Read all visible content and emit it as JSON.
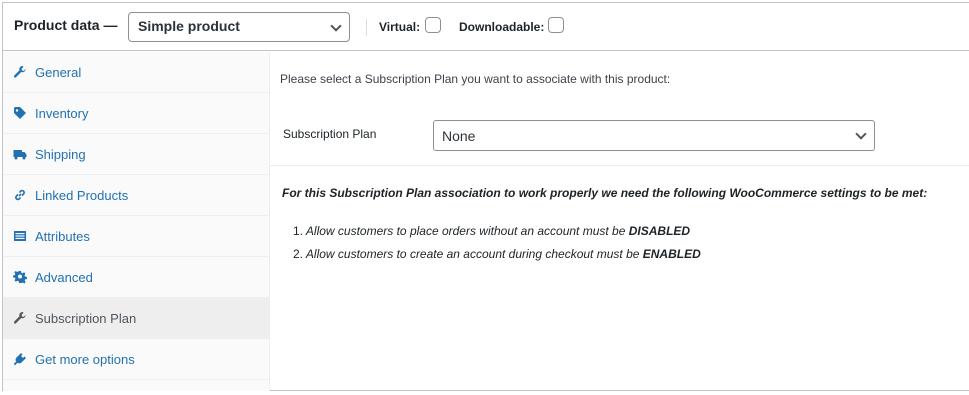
{
  "header": {
    "title": "Product data —",
    "product_type": "Simple product",
    "virtual_label": "Virtual:",
    "downloadable_label": "Downloadable:"
  },
  "sidebar": {
    "items": [
      {
        "label": "General",
        "icon": "wrench-icon"
      },
      {
        "label": "Inventory",
        "icon": "tag-icon"
      },
      {
        "label": "Shipping",
        "icon": "truck-icon"
      },
      {
        "label": "Linked Products",
        "icon": "link-icon"
      },
      {
        "label": "Attributes",
        "icon": "list-icon"
      },
      {
        "label": "Advanced",
        "icon": "gear-icon"
      },
      {
        "label": "Subscription Plan",
        "icon": "wrench-icon",
        "active": true
      },
      {
        "label": "Get more options",
        "icon": "plugin-icon"
      }
    ]
  },
  "main": {
    "intro": "Please select a Subscription Plan you want to associate with this product:",
    "plan_label": "Subscription Plan",
    "plan_value": "None",
    "notice": "For this Subscription Plan association to work properly we need the following WooCommerce settings to be met:",
    "requirements": [
      {
        "num": "1.",
        "text": "Allow customers to place orders without an account must be",
        "status": "DISABLED"
      },
      {
        "num": "2.",
        "text": "Allow customers to create an account during checkout must be",
        "status": "ENABLED"
      }
    ]
  },
  "colors": {
    "link": "#2271b1",
    "active_tab_bg": "#eeeeee",
    "sidebar_bg": "#fafafa"
  }
}
